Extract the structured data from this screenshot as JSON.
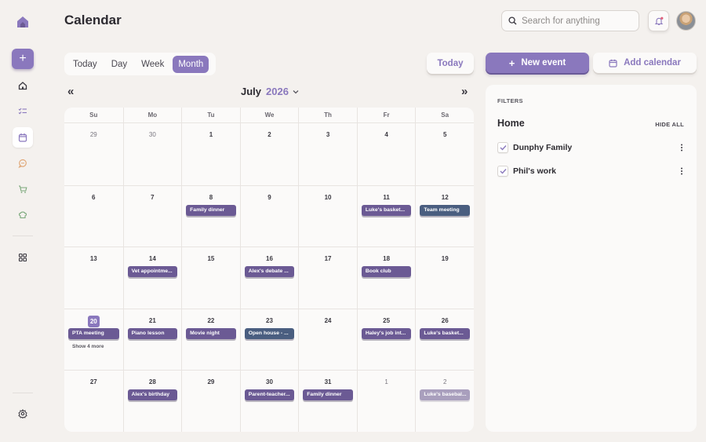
{
  "header": {
    "title": "Calendar",
    "search_placeholder": "Search for anything"
  },
  "view_tabs": {
    "tabs": [
      "Today",
      "Day",
      "Week",
      "Month"
    ],
    "active": "Month",
    "today_button": "Today"
  },
  "month_nav": {
    "prev": "«",
    "next": "»",
    "month": "July",
    "year": "2026"
  },
  "calendar": {
    "weekdays": [
      "Su",
      "Mo",
      "Tu",
      "We",
      "Th",
      "Fr",
      "Sa"
    ],
    "weeks": [
      [
        {
          "day": "29",
          "muted": true,
          "events": []
        },
        {
          "day": "30",
          "muted": true,
          "events": []
        },
        {
          "day": "1",
          "events": []
        },
        {
          "day": "2",
          "events": []
        },
        {
          "day": "3",
          "events": []
        },
        {
          "day": "4",
          "events": []
        },
        {
          "day": "5",
          "events": []
        }
      ],
      [
        {
          "day": "6",
          "events": []
        },
        {
          "day": "7",
          "events": []
        },
        {
          "day": "8",
          "events": [
            {
              "title": "Family dinner",
              "color": "purple"
            }
          ]
        },
        {
          "day": "9",
          "events": []
        },
        {
          "day": "10",
          "events": []
        },
        {
          "day": "11",
          "events": [
            {
              "title": "Luke's basket...",
              "color": "purple"
            }
          ]
        },
        {
          "day": "12",
          "events": [
            {
              "title": "Team meeting",
              "color": "blue"
            }
          ]
        }
      ],
      [
        {
          "day": "13",
          "events": []
        },
        {
          "day": "14",
          "events": [
            {
              "title": "Vet appointme...",
              "color": "purple"
            }
          ]
        },
        {
          "day": "15",
          "events": []
        },
        {
          "day": "16",
          "events": [
            {
              "title": "Alex's debate ...",
              "color": "purple"
            }
          ]
        },
        {
          "day": "17",
          "events": []
        },
        {
          "day": "18",
          "events": [
            {
              "title": "Book club",
              "color": "purple"
            }
          ]
        },
        {
          "day": "19",
          "events": []
        }
      ],
      [
        {
          "day": "20",
          "today": true,
          "events": [
            {
              "title": "PTA meeting",
              "color": "purple"
            }
          ],
          "more": "Show 4 more"
        },
        {
          "day": "21",
          "events": [
            {
              "title": "Piano lesson",
              "color": "purple"
            }
          ]
        },
        {
          "day": "22",
          "events": [
            {
              "title": "Movie night",
              "color": "purple"
            }
          ]
        },
        {
          "day": "23",
          "events": [
            {
              "title": "Open house - ...",
              "color": "blue"
            }
          ]
        },
        {
          "day": "24",
          "events": []
        },
        {
          "day": "25",
          "events": [
            {
              "title": "Haley's job int...",
              "color": "purple"
            }
          ]
        },
        {
          "day": "26",
          "events": [
            {
              "title": "Luke's basket...",
              "color": "purple"
            }
          ]
        }
      ],
      [
        {
          "day": "27",
          "events": []
        },
        {
          "day": "28",
          "events": [
            {
              "title": "Alex's birthday",
              "color": "purple"
            }
          ]
        },
        {
          "day": "29",
          "events": []
        },
        {
          "day": "30",
          "events": [
            {
              "title": "Parent-teacher...",
              "color": "purple"
            }
          ]
        },
        {
          "day": "31",
          "events": [
            {
              "title": "Family dinner",
              "color": "purple"
            }
          ]
        },
        {
          "day": "1",
          "muted": true,
          "events": []
        },
        {
          "day": "2",
          "muted": true,
          "events": [
            {
              "title": "Luke's basebal...",
              "color": "faded"
            }
          ]
        }
      ]
    ]
  },
  "actions": {
    "new_event": "New event",
    "add_calendar": "Add calendar"
  },
  "filters": {
    "label": "FILTERS",
    "group": "Home",
    "hide_all": "HIDE ALL",
    "calendars": [
      {
        "name": "Dunphy Family",
        "checked": true
      },
      {
        "name": "Phil's work",
        "checked": true
      }
    ]
  },
  "colors": {
    "accent": "#8a78bd",
    "event_purple": "#6b5a94",
    "event_blue": "#4a5e80"
  }
}
